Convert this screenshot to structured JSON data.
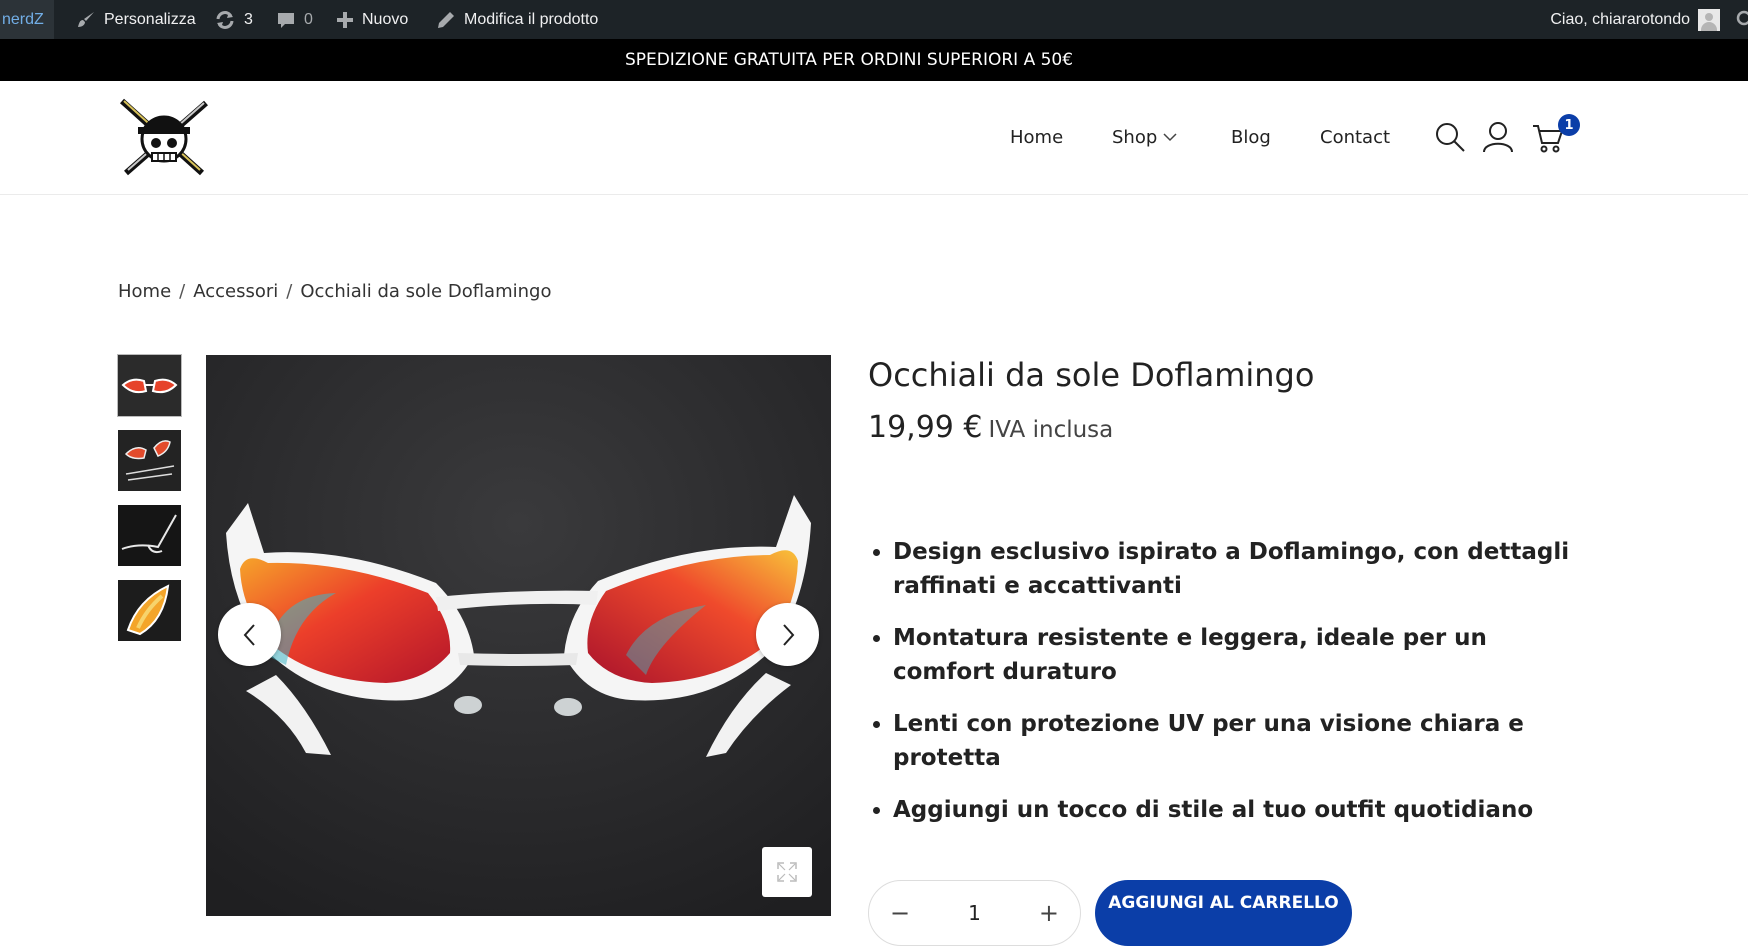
{
  "adminbar": {
    "site_name": "nerdZ",
    "customize_label": "Personalizza",
    "updates_count": "3",
    "comments_count": "0",
    "new_label": "Nuovo",
    "edit_label": "Modifica il prodotto",
    "greeting": "Ciao, chiararotondo"
  },
  "promo": {
    "text": "SPEDIZIONE GRATUITA PER ORDINI SUPERIORI A 50€"
  },
  "nav": {
    "items": [
      {
        "label": "Home"
      },
      {
        "label": "Shop"
      },
      {
        "label": "Blog"
      },
      {
        "label": "Contact"
      }
    ],
    "cart_count": "1"
  },
  "breadcrumb": {
    "items": [
      "Home",
      "Accessori",
      "Occhiali da sole Doflamingo"
    ],
    "separator": "/"
  },
  "product": {
    "title": "Occhiali da sole Doflamingo",
    "price": "19,99 €",
    "tax_note": "IVA inclusa",
    "features": [
      "Design esclusivo ispirato a Doflamingo, con dettagli raffinati e accattivanti",
      "Montatura resistente e leggera, ideale per un comfort duraturo",
      "Lenti con protezione UV per una visione chiara e protetta",
      "Aggiungi un tocco di stile al tuo outfit quotidiano"
    ],
    "quantity": "1",
    "add_to_cart_label": "AGGIUNGI AL CARRELLO"
  },
  "colors": {
    "admin_bg": "#1d2327",
    "promo_bg": "#000000",
    "accent": "#0b3ea8"
  },
  "icons": [
    "wordpress-icon",
    "brush-icon",
    "updates-icon",
    "comment-icon",
    "plus-icon",
    "pencil-icon",
    "search-icon",
    "user-icon",
    "cart-icon",
    "chevron-left-icon",
    "chevron-right-icon",
    "expand-icon"
  ]
}
